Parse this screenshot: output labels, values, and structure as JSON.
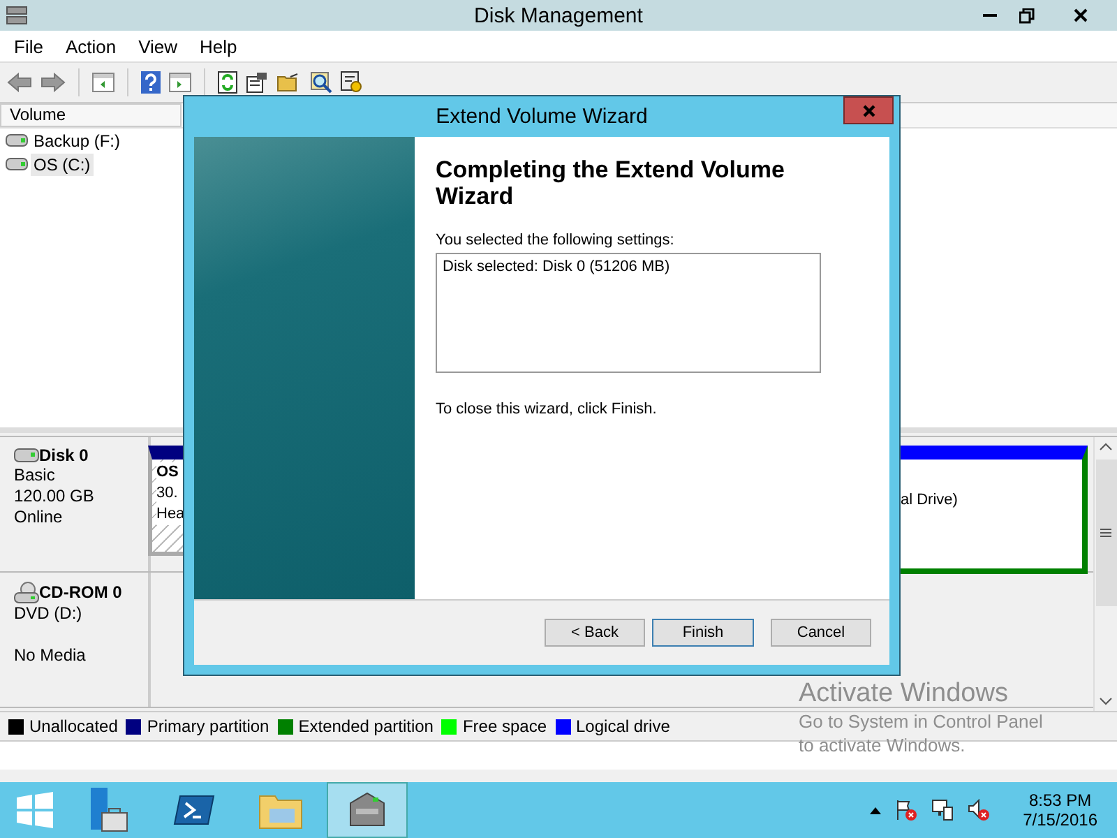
{
  "window": {
    "title": "Disk Management"
  },
  "menu": [
    {
      "label": "File"
    },
    {
      "label": "Action"
    },
    {
      "label": "View"
    },
    {
      "label": "Help"
    }
  ],
  "volume_list": {
    "columns": [
      {
        "label": "Volume"
      }
    ],
    "rows": [
      {
        "name": "Backup (F:)",
        "selected": false
      },
      {
        "name": "OS (C:)",
        "selected": true
      }
    ]
  },
  "disks": [
    {
      "name": "Disk 0",
      "kind": "hdd",
      "type": "Basic",
      "size": "120.00 GB",
      "status": "Online",
      "partitions": [
        {
          "kind": "primary",
          "lines": [
            "OS",
            "30.",
            "Hea"
          ]
        },
        {
          "kind": "logical",
          "lines": [
            "al Drive)"
          ]
        }
      ]
    },
    {
      "name": "CD-ROM 0",
      "kind": "cdrom",
      "type": "DVD (D:)",
      "status": "No Media"
    }
  ],
  "legend": [
    {
      "label": "Unallocated",
      "color": "#000000"
    },
    {
      "label": "Primary partition",
      "color": "#000080"
    },
    {
      "label": "Extended partition",
      "color": "#008000"
    },
    {
      "label": "Free space",
      "color": "#00ff00"
    },
    {
      "label": "Logical drive",
      "color": "#0000ff"
    }
  ],
  "dialog": {
    "title": "Extend Volume Wizard",
    "heading": "Completing the Extend Volume Wizard",
    "intro": "You selected the following settings:",
    "settings": "Disk selected: Disk 0 (51206 MB)",
    "note": "To close this wizard, click Finish.",
    "buttons": [
      {
        "label": "< Back",
        "default": false
      },
      {
        "label": "Finish",
        "default": true
      },
      {
        "label": "Cancel",
        "default": false
      }
    ]
  },
  "activation": {
    "title": "Activate Windows",
    "lines": [
      "Go to System in Control Panel",
      "to activate Windows."
    ]
  },
  "taskbar": {
    "apps": [
      {
        "kind": "server",
        "selected": false
      },
      {
        "kind": "shell",
        "selected": false
      },
      {
        "kind": "folder",
        "selected": false
      },
      {
        "kind": "disk",
        "selected": true
      }
    ],
    "time": "8:53 PM",
    "date": "7/15/2016"
  }
}
